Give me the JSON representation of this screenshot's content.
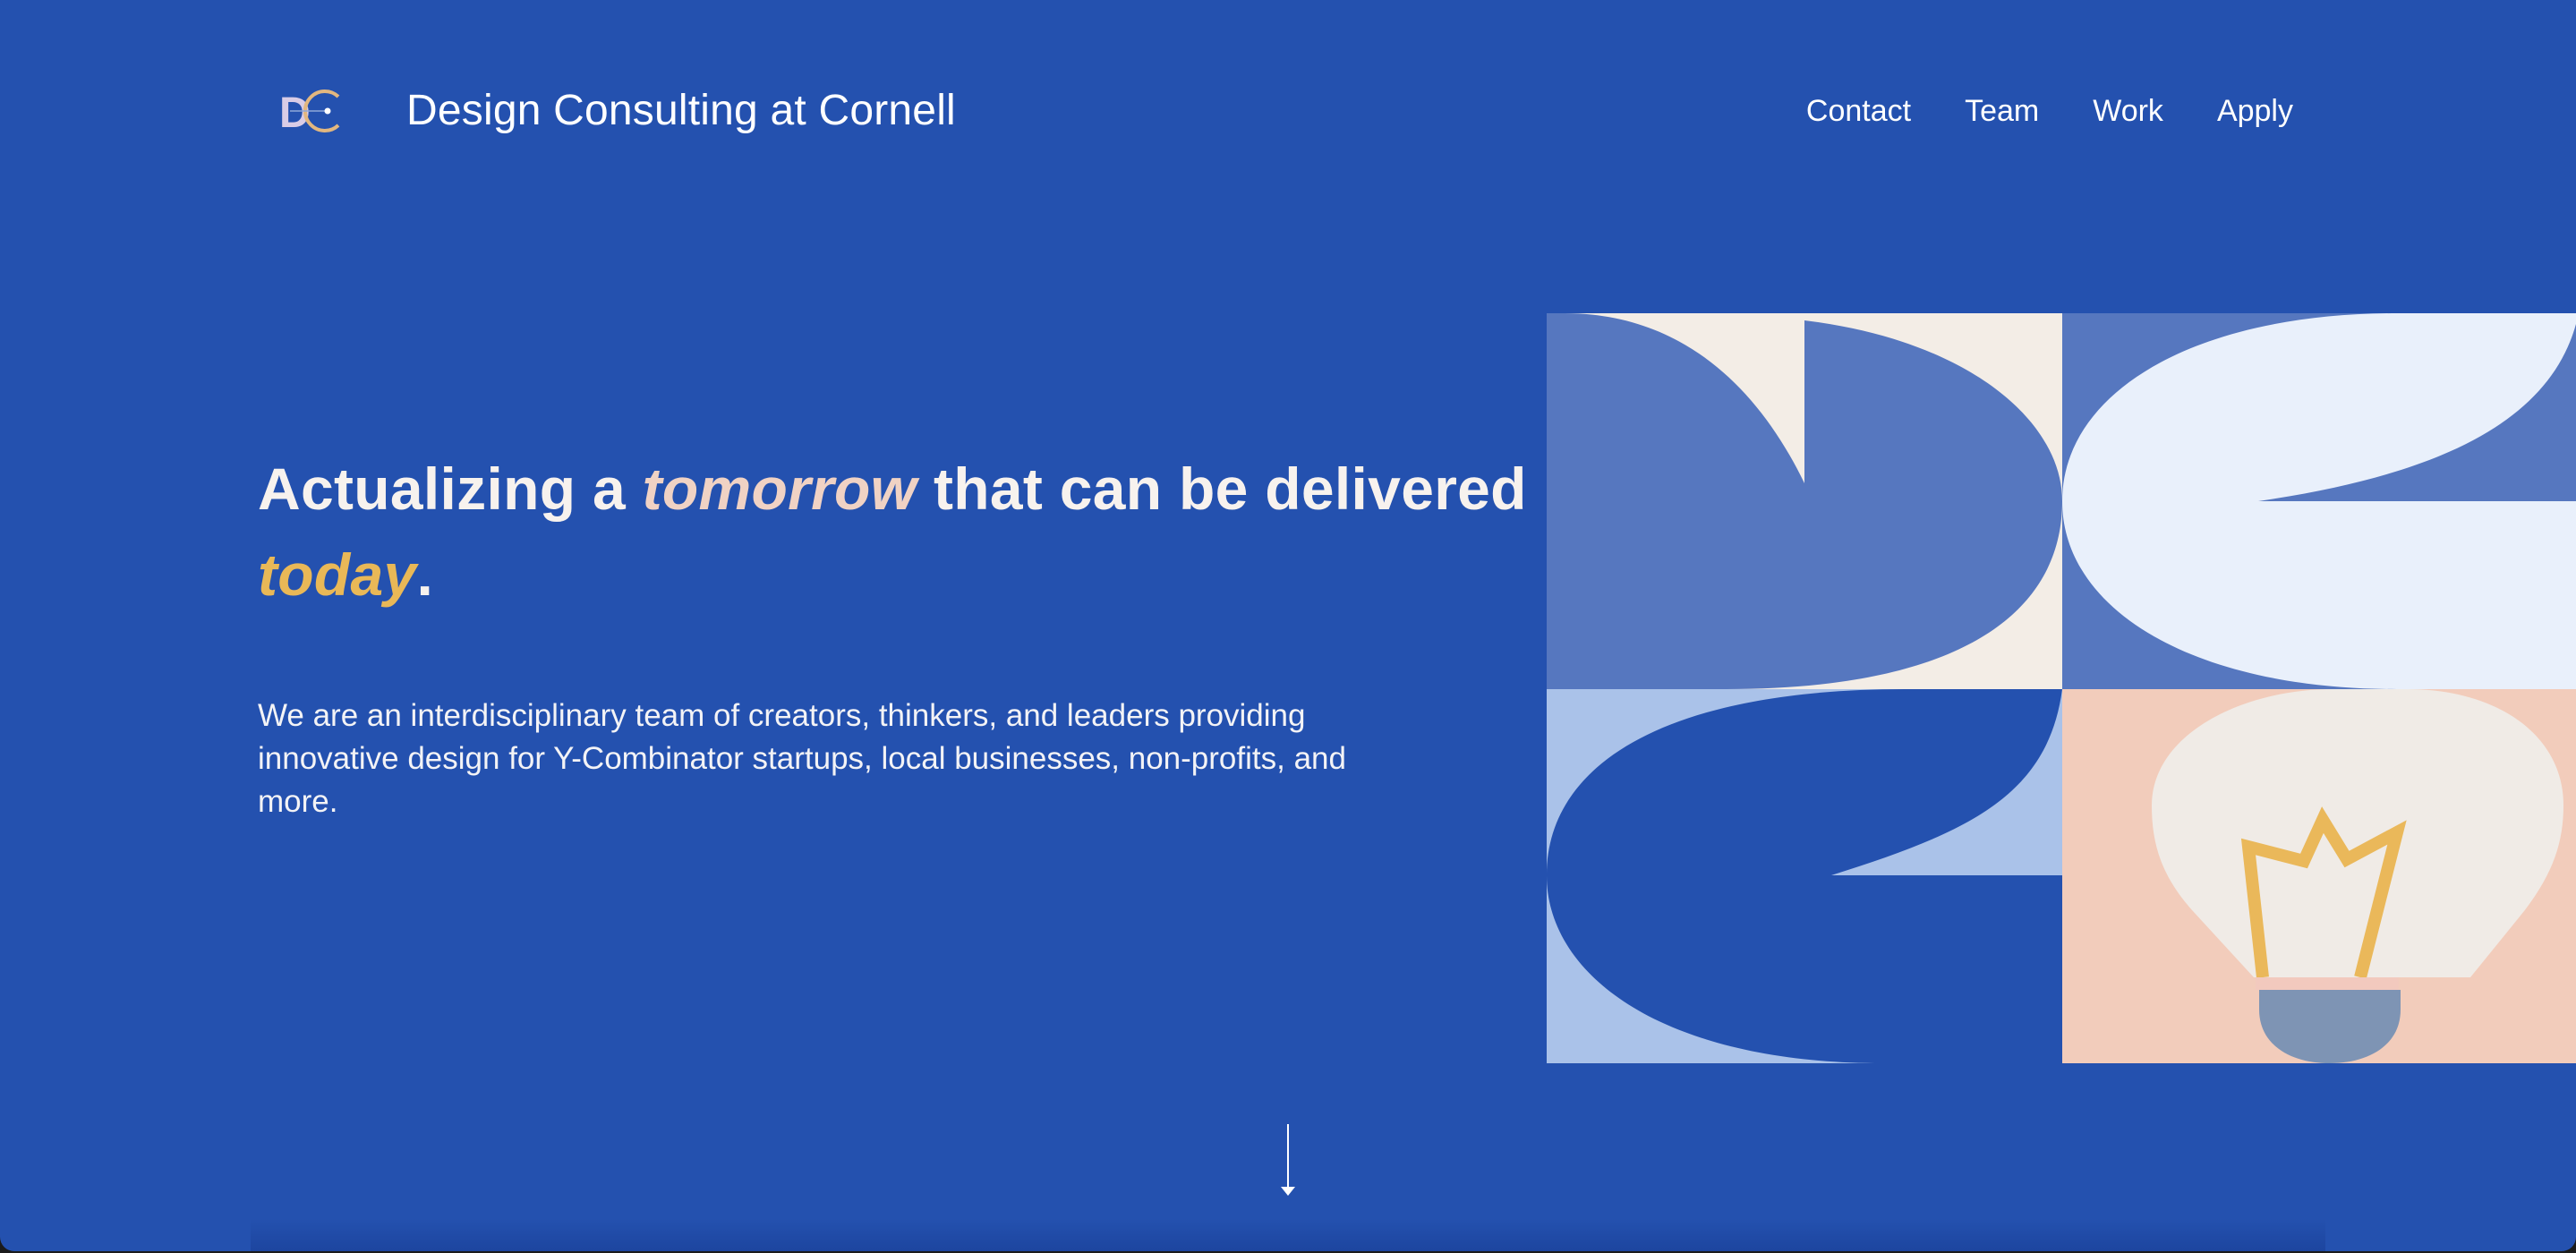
{
  "header": {
    "brand": "Design Consulting at Cornell",
    "logo_icon": "dc-logo-icon",
    "nav": [
      {
        "label": "Contact"
      },
      {
        "label": "Team"
      },
      {
        "label": "Work"
      },
      {
        "label": "Apply"
      }
    ]
  },
  "hero": {
    "headline_start": "Actualizing a ",
    "headline_highlight_1": "tomorrow",
    "headline_middle": " that can be delivered ",
    "headline_highlight_2": "today",
    "headline_end": ".",
    "intro": "We are an interdisciplinary team of creators, thinkers, and leaders providing innovative design for Y-Combinator startups, local businesses, non-profits, and more.",
    "illustration_icon": "dc-lightbulb-mosaic-icon",
    "scroll_icon": "arrow-down-icon"
  },
  "colors": {
    "background": "#2451af",
    "text": "#ffffff",
    "highlight_tomorrow": "#f0d2c4",
    "highlight_today": "#e9b857",
    "tile_cream": "#f3ede6",
    "tile_mid_blue": "#5677bf",
    "tile_pale": "#e9f0fb",
    "tile_light_blue": "#aac2e9",
    "tile_peach": "#f2ccbb",
    "bulb_gold": "#eab85a",
    "bulb_base": "#7e94b4"
  }
}
